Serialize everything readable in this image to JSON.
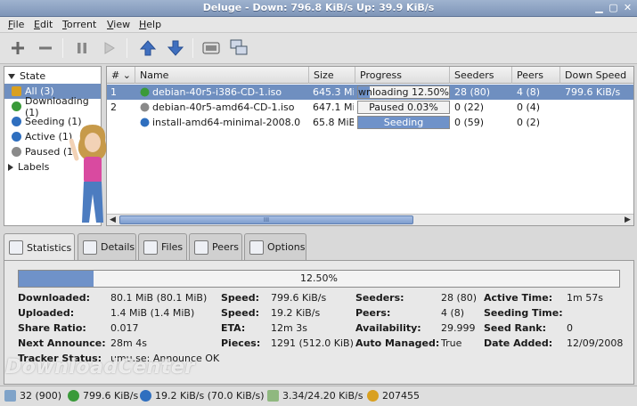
{
  "window": {
    "title": "Deluge - Down: 796.8 KiB/s Up: 39.9 KiB/s"
  },
  "menu": [
    {
      "key": "F",
      "rest": "ile"
    },
    {
      "key": "E",
      "rest": "dit"
    },
    {
      "key": "T",
      "rest": "orrent"
    },
    {
      "key": "V",
      "rest": "iew"
    },
    {
      "key": "H",
      "rest": "elp"
    }
  ],
  "sidebar": {
    "header": "State",
    "items": [
      {
        "label": "All (3)",
        "color": "#d9a020"
      },
      {
        "label": "Downloading (1)",
        "color": "#3a9a3a"
      },
      {
        "label": "Seeding (1)",
        "color": "#2f6fbf"
      },
      {
        "label": "Active (1)",
        "color": "#2f6fbf"
      },
      {
        "label": "Paused (1",
        "color": "#8a8a8a"
      }
    ],
    "labels_row": "Labels"
  },
  "table": {
    "columns": [
      "#",
      "Name",
      "Size",
      "Progress",
      "Seeders",
      "Peers",
      "Down Speed"
    ],
    "rows": [
      {
        "num": "1",
        "name": "debian-40r5-i386-CD-1.iso",
        "size": "645.3 MiB",
        "progress_text": "wnloading 12.50%",
        "progress": 0.125,
        "seeders": "28 (80)",
        "peers": "4 (8)",
        "down": "799.6 KiB/s",
        "icon": "downloading-icon",
        "icon_color": "#3a9a3a"
      },
      {
        "num": "2",
        "name": "debian-40r5-amd64-CD-1.iso",
        "size": "647.1 MiB",
        "progress_text": "Paused 0.03%",
        "progress": 0.0003,
        "seeders": "0 (22)",
        "peers": "0 (4)",
        "down": "",
        "icon": "paused-icon",
        "icon_color": "#8a8a8a"
      },
      {
        "num": "",
        "name": "install-amd64-minimal-2008.0",
        "size": "65.8 MiB",
        "progress_text": "Seeding",
        "progress": 1.0,
        "seeders": "0 (59)",
        "peers": "0 (2)",
        "down": "",
        "icon": "seeding-icon",
        "icon_color": "#2f6fbf"
      }
    ],
    "scroll_mark": "III"
  },
  "tabs": [
    {
      "label": "Statistics",
      "active": true
    },
    {
      "label": "Details",
      "active": false
    },
    {
      "label": "Files",
      "active": false
    },
    {
      "label": "Peers",
      "active": false
    },
    {
      "label": "Options",
      "active": false
    }
  ],
  "stats": {
    "progress_text": "12.50%",
    "progress": 0.125,
    "col1": [
      {
        "label": "Downloaded:",
        "value": "80.1 MiB (80.1 MiB)"
      },
      {
        "label": "Uploaded:",
        "value": "1.4 MiB (1.4 MiB)"
      },
      {
        "label": "Share Ratio:",
        "value": "0.017"
      },
      {
        "label": "Next Announce:",
        "value": "28m 4s"
      },
      {
        "label": "Tracker Status:",
        "value": "umu.se: Announce OK"
      }
    ],
    "col2": [
      {
        "label": "Speed:",
        "value": "799.6 KiB/s"
      },
      {
        "label": "Speed:",
        "value": "19.2 KiB/s"
      },
      {
        "label": "ETA:",
        "value": "12m 3s"
      },
      {
        "label": "Pieces:",
        "value": "1291 (512.0 KiB)"
      }
    ],
    "col3": [
      {
        "label": "Seeders:",
        "value": "28 (80)"
      },
      {
        "label": "Peers:",
        "value": "4 (8)"
      },
      {
        "label": "Availability:",
        "value": "29.999"
      },
      {
        "label": "Auto Managed:",
        "value": "True"
      }
    ],
    "col4": [
      {
        "label": "Active Time:",
        "value": "1m 57s"
      },
      {
        "label": "Seeding Time:",
        "value": ""
      },
      {
        "label": "Seed Rank:",
        "value": "0"
      },
      {
        "label": "Date Added:",
        "value": "12/09/2008"
      }
    ]
  },
  "statusbar": {
    "connections": "32 (900)",
    "down": "799.6 KiB/s",
    "up": "19.2 KiB/s (70.0 KiB/s)",
    "protocol": "3.34/24.20 KiB/s",
    "dht": "207455"
  },
  "watermark": "DownloadCenter",
  "colors": {
    "selection": "#6f8fc0",
    "progress_fill": "#6f92c9",
    "titlebar": "#8ea3c4"
  }
}
